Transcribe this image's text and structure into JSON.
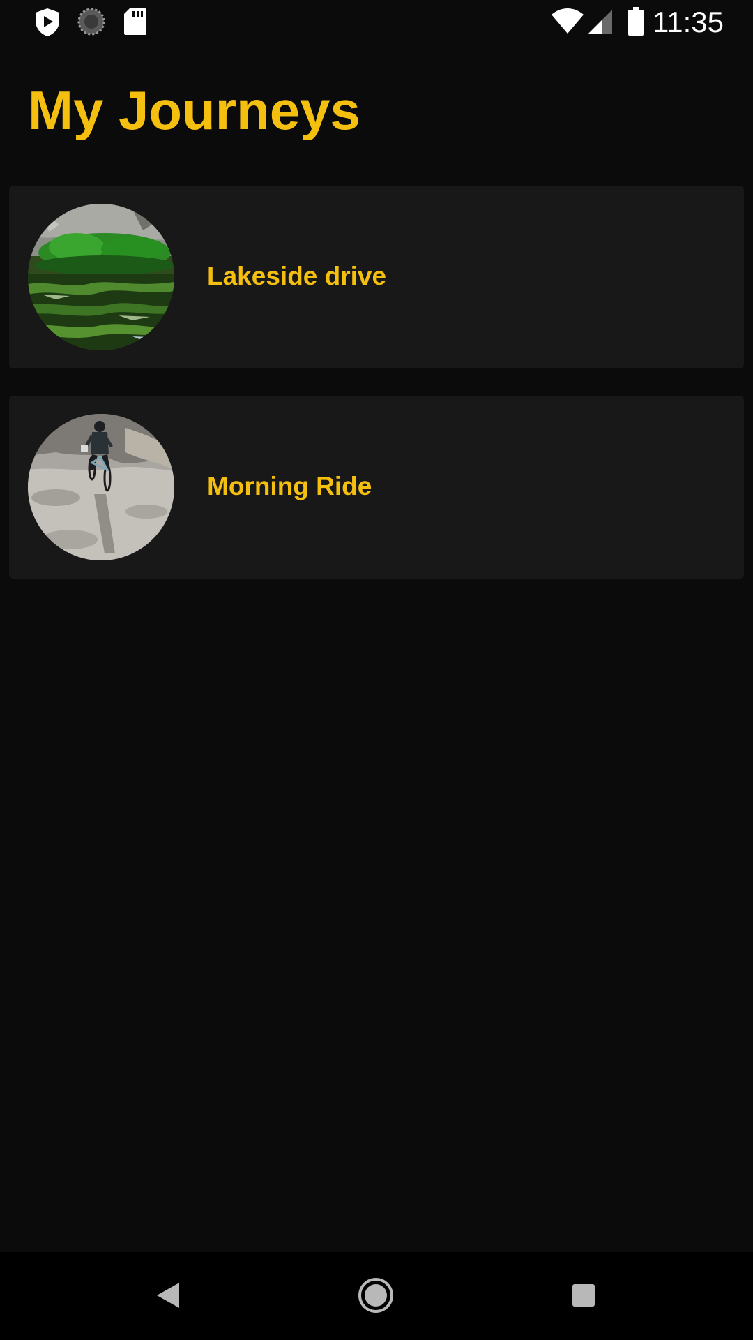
{
  "status_bar": {
    "time": "11:35",
    "left_icons": [
      "play-protect-icon",
      "sync-icon",
      "sd-card-icon"
    ],
    "right_icons": [
      "wifi-icon",
      "cell-signal-icon",
      "battery-icon"
    ]
  },
  "header": {
    "title": "My Journeys"
  },
  "journeys": [
    {
      "name": "Lakeside drive",
      "thumbnail": "lake-photo"
    },
    {
      "name": "Morning Ride",
      "thumbnail": "cyclist-photo"
    }
  ],
  "nav_bar": {
    "buttons": [
      "back-icon",
      "home-icon",
      "recents-icon"
    ]
  },
  "colors": {
    "accent": "#f5bf10",
    "background": "#0b0b0b",
    "card": "#181818"
  }
}
